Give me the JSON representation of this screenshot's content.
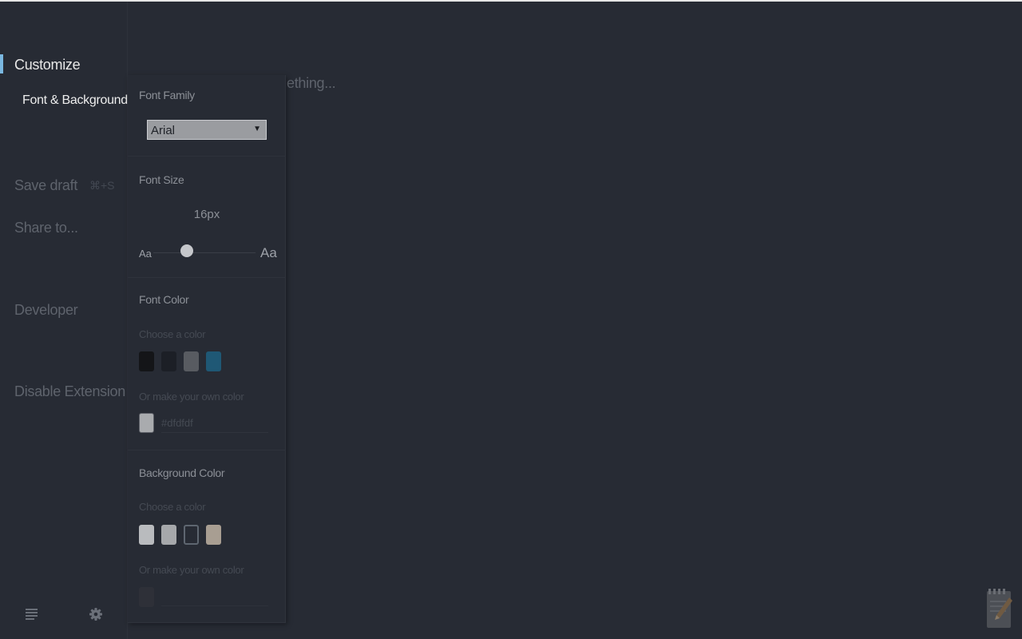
{
  "sidebar": {
    "customize": "Customize",
    "font_background": "Font & Background",
    "save_draft": "Save draft",
    "save_shortcut": "⌘+S",
    "share": "Share to...",
    "developer": "Developer",
    "disable": "Disable Extension",
    "bottom_icons": [
      "list-icon",
      "gear-icon"
    ]
  },
  "editor": {
    "placeholder_fragment": "ething..."
  },
  "panel": {
    "font_family": {
      "title": "Font Family",
      "selected": "Arial"
    },
    "font_size": {
      "title": "Font Size",
      "value": "16px",
      "small_label": "Aa",
      "large_label": "Aa",
      "slider_level": 0.27
    },
    "font_color": {
      "title": "Font Color",
      "choose": "Choose a color",
      "swatches": [
        "#141518",
        "#1c1f26",
        "#585b61",
        "#1f5875"
      ],
      "own": "Or make your own color",
      "custom_swatch": "#a9abae",
      "hex_value": "#dfdfdf"
    },
    "background_color": {
      "title": "Background Color",
      "choose": "Choose a color",
      "swatches": [
        "#b9bbbe",
        "#a6a8ab",
        "#272b34",
        "#a89e92"
      ],
      "own": "Or make your own color",
      "custom_swatch": "#2e3038"
    }
  },
  "colors": {
    "accent": "#7ab7e0",
    "background": "#272b34"
  },
  "corner_icon": "notepad-pencil-icon"
}
